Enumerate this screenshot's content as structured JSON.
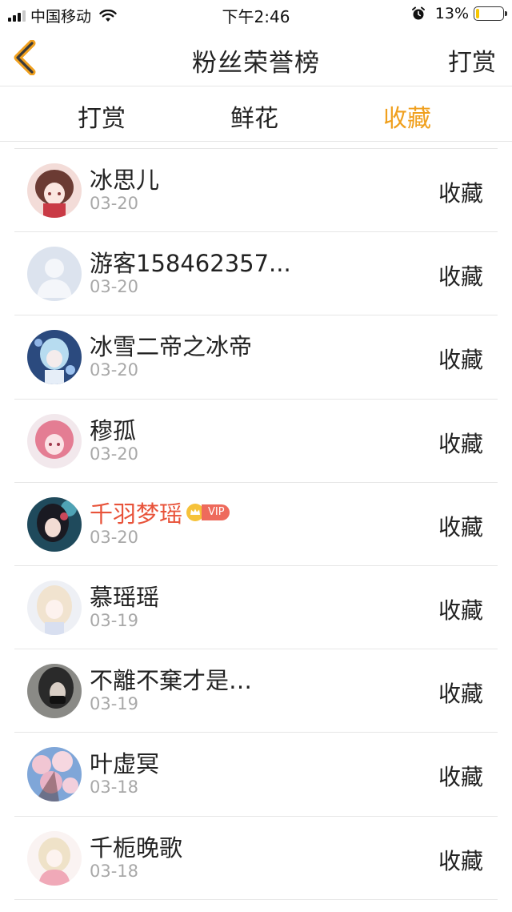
{
  "status_bar": {
    "carrier": "中国移动",
    "time": "下午2:46",
    "battery_percent": "13%",
    "battery_level": 0.13
  },
  "nav": {
    "title": "粉丝荣誉榜",
    "action_label": "打赏",
    "back_icon": "chevron-left-icon"
  },
  "colors": {
    "accent": "#f0a01e",
    "vip_name": "#e8533a",
    "date_gray": "#a8a8a8"
  },
  "tabs": [
    {
      "label": "打赏",
      "active": false
    },
    {
      "label": "鲜花",
      "active": false
    },
    {
      "label": "收藏",
      "active": true
    }
  ],
  "fans": [
    {
      "name": "冰思儿",
      "date": "03-20",
      "action": "收藏",
      "vip": false
    },
    {
      "name": "游客158462357...",
      "date": "03-20",
      "action": "收藏",
      "vip": false
    },
    {
      "name": "冰雪二帝之冰帝",
      "date": "03-20",
      "action": "收藏",
      "vip": false
    },
    {
      "name": "穆孤",
      "date": "03-20",
      "action": "收藏",
      "vip": false
    },
    {
      "name": "千羽梦瑶",
      "date": "03-20",
      "action": "收藏",
      "vip": true,
      "vip_label": "VIP"
    },
    {
      "name": "慕瑶瑶",
      "date": "03-19",
      "action": "收藏",
      "vip": false
    },
    {
      "name": "不離不棄才是…",
      "date": "03-19",
      "action": "收藏",
      "vip": false
    },
    {
      "name": "叶虚冥",
      "date": "03-18",
      "action": "收藏",
      "vip": false
    },
    {
      "name": "千栀晚歌",
      "date": "03-18",
      "action": "收藏",
      "vip": false
    }
  ]
}
